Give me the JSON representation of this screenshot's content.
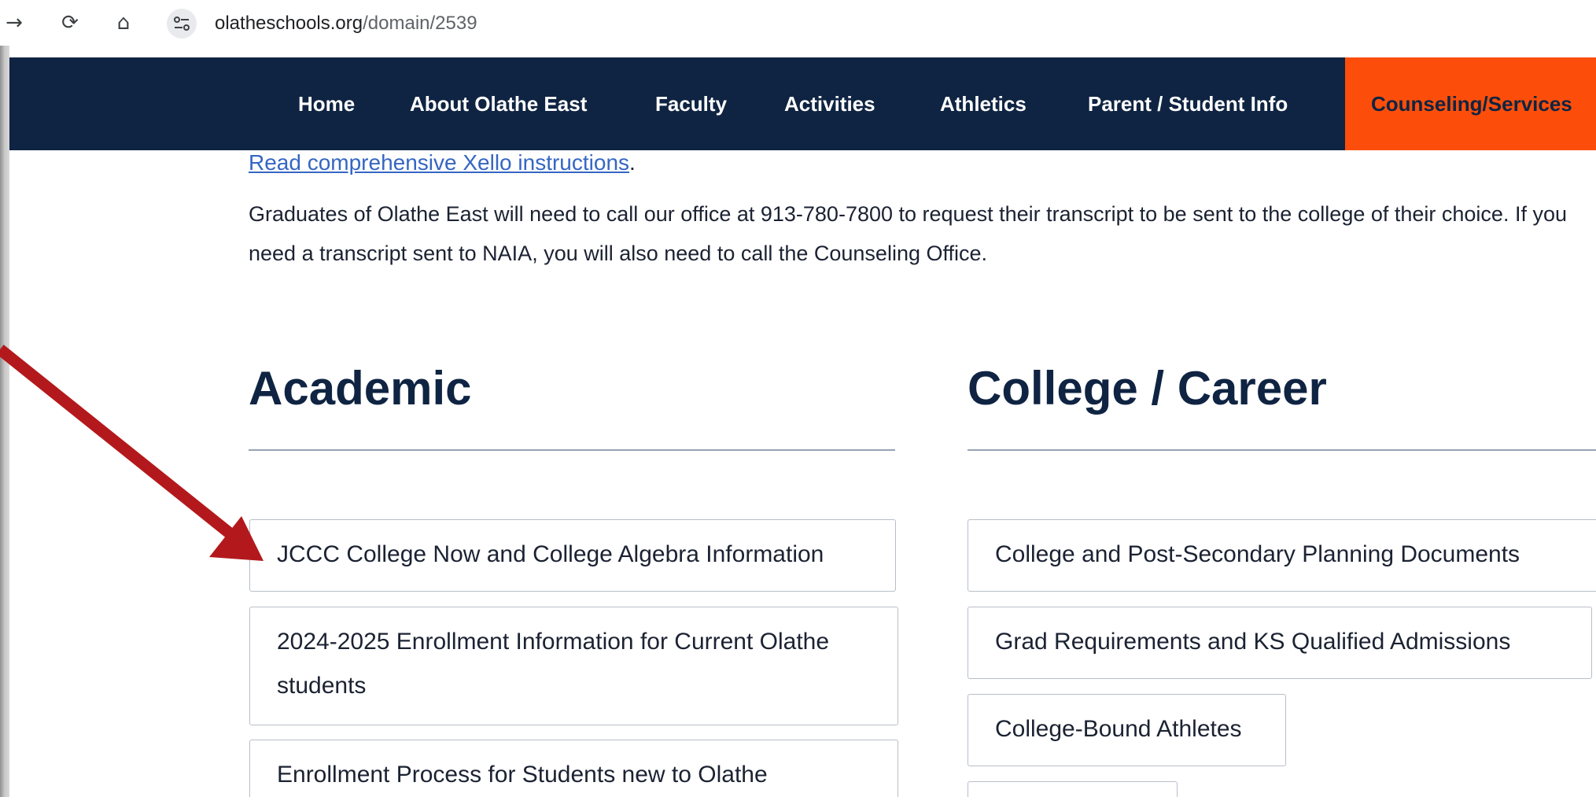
{
  "browser": {
    "url_domain": "olatheschools.org",
    "url_path": "/domain/2539",
    "icons": [
      "forward-icon",
      "reload-icon",
      "home-icon",
      "site-info-icon"
    ]
  },
  "nav": {
    "items": [
      "Home",
      "About Olathe East",
      "Faculty",
      "Activities",
      "Athletics",
      "Parent / Student Info"
    ],
    "active": "Counseling/Services",
    "colors": {
      "bar": "#0f2442",
      "active": "#fc4e0a"
    }
  },
  "main": {
    "xello_link": "Read comprehensive Xello instructions",
    "xello_period": ".",
    "transcript_text": "Graduates of Olathe East will need to call our office at 913-780-7800 to request their transcript to be sent to the college of their choice. If you need a transcript sent to NAIA, you will also need to call the Counseling Office.",
    "academic": {
      "title": "Academic",
      "links": [
        "JCCC College Now and College Algebra Information",
        "2024-2025 Enrollment Information for Current Olathe students",
        "Enrollment Process for Students new to Olathe"
      ]
    },
    "college": {
      "title": "College / Career",
      "links": [
        "College and Post-Secondary Planning Documents",
        "Grad Requirements and KS Qualified Admissions",
        "College-Bound Athletes",
        ""
      ]
    }
  },
  "annotation": {
    "arrow_color": "#b3191c"
  }
}
